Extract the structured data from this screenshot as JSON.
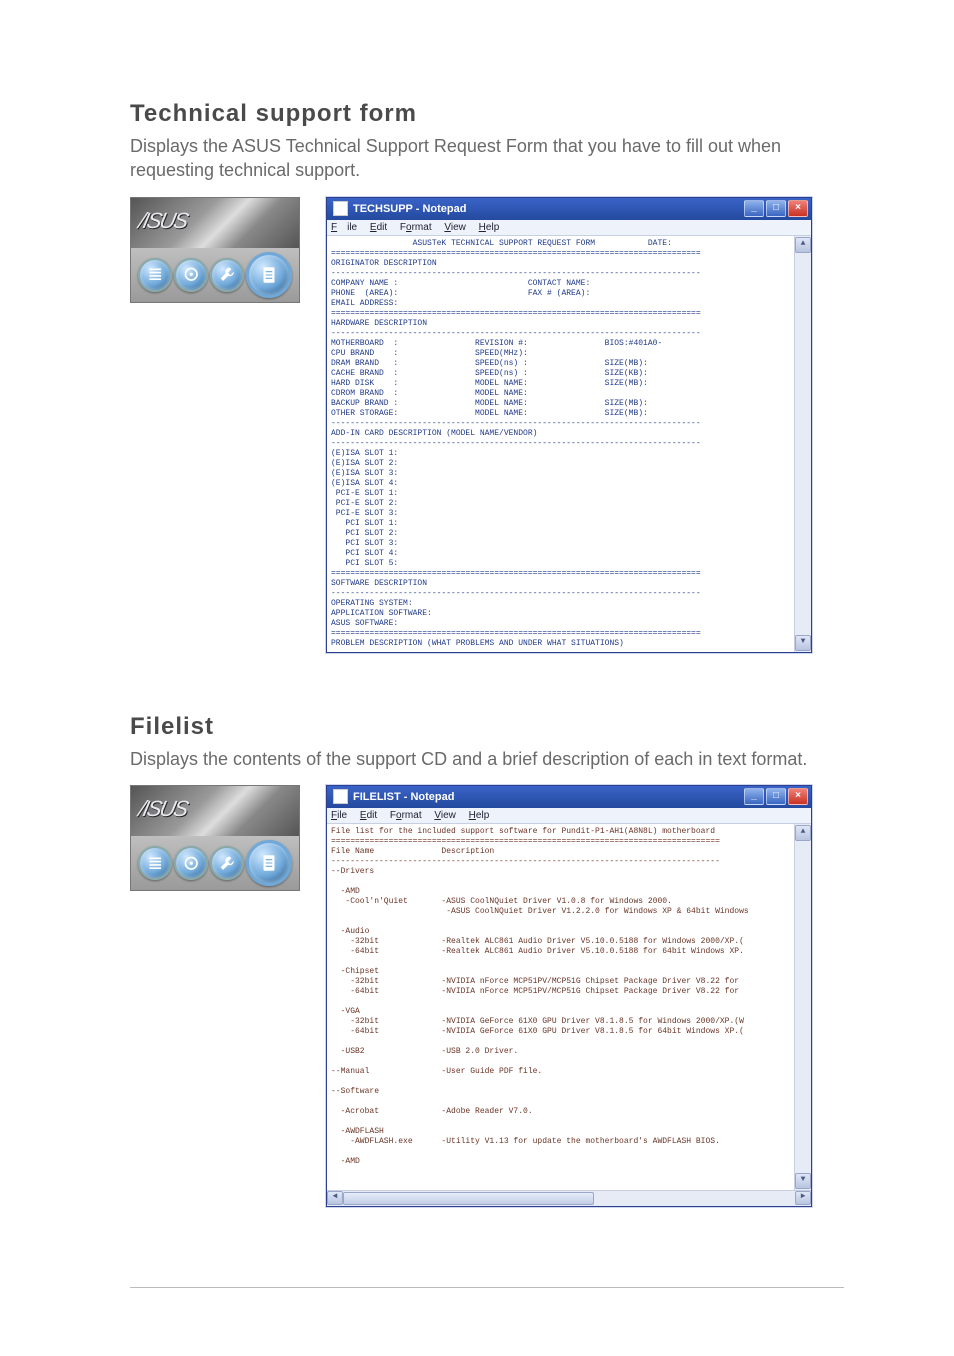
{
  "section1": {
    "title": "Technical support form",
    "desc": "Displays the ASUS Technical Support Request Form that you have to fill out when requesting technical support."
  },
  "section2": {
    "title": "Filelist",
    "desc": "Displays the contents of the support CD and a brief description of each in text format."
  },
  "menubar": {
    "file": "File",
    "edit": "Edit",
    "format": "Format",
    "view": "View",
    "help": "Help"
  },
  "winbtn": {
    "min": "_",
    "max": "□",
    "close": "×"
  },
  "notepad1": {
    "title": "TECHSUPP - Notepad",
    "body": "                 ASUSTeK TECHNICAL SUPPORT REQUEST FORM           DATE:\n=============================================================================\nORIGINATOR DESCRIPTION\n-----------------------------------------------------------------------------\nCOMPANY NAME :                           CONTACT NAME:\nPHONE  (AREA):                           FAX # (AREA):\nEMAIL ADDRESS:\n=============================================================================\nHARDWARE DESCRIPTION\n-----------------------------------------------------------------------------\nMOTHERBOARD  :                REVISION #:                BIOS:#401A0-\nCPU BRAND    :                SPEED(MHz):\nDRAM BRAND   :                SPEED(ns) :                SIZE(MB):\nCACHE BRAND  :                SPEED(ns) :                SIZE(KB):\nHARD DISK    :                MODEL NAME:                SIZE(MB):\nCDROM BRAND  :                MODEL NAME:\nBACKUP BRAND :                MODEL NAME:                SIZE(MB):\nOTHER STORAGE:                MODEL NAME:                SIZE(MB):\n-----------------------------------------------------------------------------\nADD-IN CARD DESCRIPTION (MODEL NAME/VENDOR)\n-----------------------------------------------------------------------------\n(E)ISA SLOT 1:\n(E)ISA SLOT 2:\n(E)ISA SLOT 3:\n(E)ISA SLOT 4:\n PCI-E SLOT 1:\n PCI-E SLOT 2:\n PCI-E SLOT 3:\n   PCI SLOT 1:\n   PCI SLOT 2:\n   PCI SLOT 3:\n   PCI SLOT 4:\n   PCI SLOT 5:\n=============================================================================\nSOFTWARE DESCRIPTION\n-----------------------------------------------------------------------------\nOPERATING SYSTEM:\nAPPLICATION SOFTWARE:\nASUS SOFTWARE:\n=============================================================================\nPROBLEM DESCRIPTION (WHAT PROBLEMS AND UNDER WHAT SITUATIONS)\n"
  },
  "notepad2": {
    "title": "FILELIST - Notepad",
    "body": "File list for the included support software for Pundit-P1-AH1(A8N8L) motherboard\n=================================================================================\nFile Name              Description\n---------------------------------------------------------------------------------\n--Drivers\n\n  -AMD\n   -Cool'n'Quiet       -ASUS CoolNQuiet Driver V1.0.8 for Windows 2000.\n                        -ASUS CoolNQuiet Driver V1.2.2.0 for Windows XP & 64bit Windows\n\n  -Audio\n    -32bit             -Realtek ALC861 Audio Driver V5.10.0.5188 for Windows 2000/XP.(\n    -64bit             -Realtek ALC861 Audio Driver V5.10.0.5188 for 64bit Windows XP.\n\n  -Chipset\n    -32bit             -NVIDIA nForce MCP51PV/MCP51G Chipset Package Driver V8.22 for\n    -64bit             -NVIDIA nForce MCP51PV/MCP51G Chipset Package Driver V8.22 for\n\n  -VGA\n    -32bit             -NVIDIA GeForce 61X0 GPU Driver V8.1.8.5 for Windows 2000/XP.(W\n    -64bit             -NVIDIA GeForce 61X0 GPU Driver V8.1.8.5 for 64bit Windows XP.(\n\n  -USB2                -USB 2.0 Driver.\n\n--Manual               -User Guide PDF file.\n\n--Software\n\n  -Acrobat             -Adobe Reader V7.0.\n\n  -AWDFLASH\n    -AWDFLASH.exe      -Utility V1.13 for update the motherboard's AWDFLASH BIOS.\n\n  -AMD\n"
  }
}
